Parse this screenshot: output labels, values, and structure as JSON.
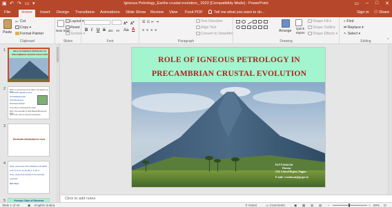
{
  "titlebar": {
    "title": "Igneous Petrology_Earths crustal evolution_ 2022 [Compatibility Mode] - PowerPoint"
  },
  "ribbon_tabs": [
    "File",
    "Home",
    "Insert",
    "Design",
    "Transitions",
    "Animations",
    "Slide Show",
    "Review",
    "View",
    "Foxit PDF"
  ],
  "tell_me": "Tell me what you want to do...",
  "sign_in": "Sign in",
  "share": "Share",
  "clipboard": {
    "paste": "Paste",
    "cut": "Cut",
    "copy": "Copy",
    "format_painter": "Format Painter",
    "label": "Clipboard"
  },
  "slides_group": {
    "new_slide": "New Slide",
    "layout": "Layout",
    "reset": "Reset",
    "section": "Section",
    "label": "Slides"
  },
  "font_group": {
    "label": "Font",
    "bold": "B",
    "italic": "I",
    "underline": "U",
    "strike": "S",
    "shadow": "abc",
    "spacing": "AV",
    "case": "Aa"
  },
  "paragraph_group": {
    "text_direction": "Text Direction",
    "align_text": "Align Text",
    "convert_smartart": "Convert to SmartArt",
    "label": "Paragraph"
  },
  "drawing_group": {
    "arrange": "Arrange",
    "quick_styles": "Quick Styles",
    "shape_fill": "Shape Fill",
    "shape_outline": "Shape Outline",
    "shape_effects": "Shape Effects",
    "label": "Drawing"
  },
  "editing_group": {
    "find": "Find",
    "replace": "Replace",
    "select": "Select",
    "label": "Editing"
  },
  "thumbnails": [
    {
      "num": "1",
      "lines": [
        "ROLE OF IGNEOUS PETROLOGY IN",
        "PRECAMBRIAN CRUSTAL EVOLUTION"
      ]
    },
    {
      "num": "2",
      "lines": [
        "Rocks, in general need to be taken in the Earths and thus",
        "Continental magmatic process:",
        "Thermal/Metamorphic",
        "Chemical structure:",
        "Mechanical behavior:",
        "In the above is discussed the ocean",
        "Rock: Two essentials of Solid-Material Mineral and sheet",
        "Rock of the crust by chemical composition"
      ]
    },
    {
      "num": "3",
      "lines": [
        "Elemental distribution in crust"
      ]
    },
    {
      "num": "4",
      "lines": [
        "Rocks, elements are those ubiquitous in the Earths",
        "crust: Si, Al, Fe, Ca, Na, Mg, K, Ti, Mn, P",
        "These: elements are abundant in the elemental",
        "compound",
        "Note: these"
      ]
    },
    {
      "num": "5",
      "lines": [
        "Periodic Table of Elements"
      ]
    }
  ],
  "slide": {
    "title_line1": "ROLE OF IGNEOUS PETROLOGY IN",
    "title_line2": "PRECAMBRIAN CRUSTAL EVOLUTION",
    "caption": [
      "Dr.V.V.Sesha Sai",
      "Director",
      "GSI, Central Region, Nagpur",
      "E-mail : vvsesha.sai@gsi.gov.in"
    ]
  },
  "notes_placeholder": "Click to add notes",
  "status": {
    "slide_of": "Slide 1 of 42",
    "language": "English (India)",
    "notes": "Notes",
    "comments": "Comments",
    "zoom": "69%"
  },
  "colors": {
    "accent": "#b7472a",
    "slide_title": "#b71c1c",
    "slide_header_bg": "#a2f5cf"
  }
}
